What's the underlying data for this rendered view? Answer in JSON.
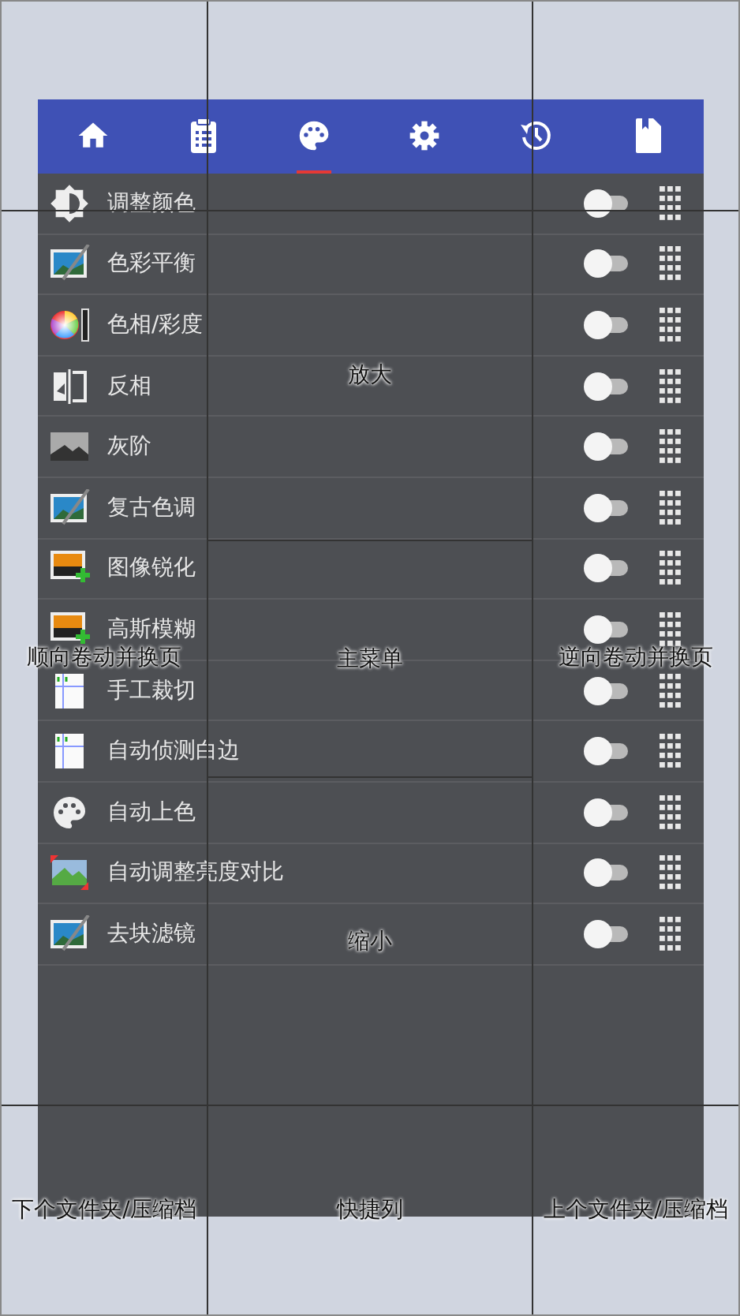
{
  "tabs": [
    {
      "selected": false
    },
    {
      "selected": false
    },
    {
      "selected": true
    },
    {
      "selected": false
    },
    {
      "selected": false
    },
    {
      "selected": false
    }
  ],
  "items": [
    {
      "label": "调整颜色",
      "on": false
    },
    {
      "label": "色彩平衡",
      "on": false
    },
    {
      "label": "色相/彩度",
      "on": false
    },
    {
      "label": "反相",
      "on": false
    },
    {
      "label": "灰阶",
      "on": false
    },
    {
      "label": "复古色调",
      "on": false
    },
    {
      "label": "图像锐化",
      "on": false
    },
    {
      "label": "高斯模糊",
      "on": false
    },
    {
      "label": "手工裁切",
      "on": false
    },
    {
      "label": "自动侦测白边",
      "on": false
    },
    {
      "label": "自动上色",
      "on": false
    },
    {
      "label": "自动调整亮度对比",
      "on": false
    },
    {
      "label": "去块滤镜",
      "on": false
    }
  ],
  "zones": {
    "zoom_in": "放大",
    "scroll_forward": "顺向卷动并换页",
    "main_menu": "主菜单",
    "scroll_backward": "逆向卷动并换页",
    "zoom_out": "缩小",
    "next_folder": "下个文件夹/压缩档",
    "toolbar": "快捷列",
    "prev_folder": "上个文件夹/压缩档"
  }
}
